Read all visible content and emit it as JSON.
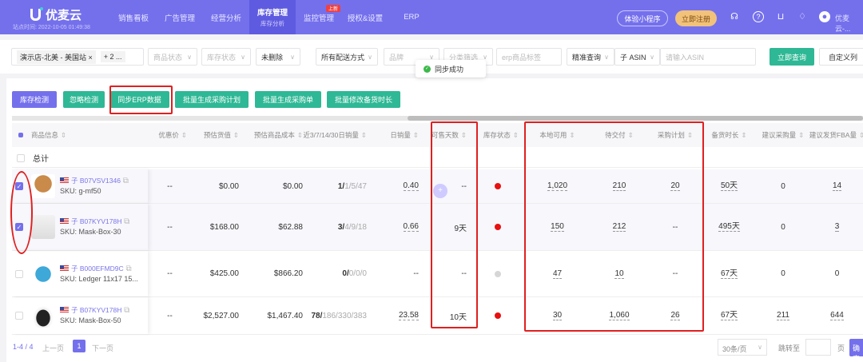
{
  "nav": {
    "brand": "优麦云",
    "site_time": "站点时间: 2022-10-05 01:49:38",
    "menu": [
      {
        "label": "销售看板"
      },
      {
        "label": "广告管理"
      },
      {
        "label": "经营分析"
      },
      {
        "label": "库存管理",
        "sub": "库存分析",
        "active": true
      },
      {
        "label": "监控管理",
        "badge": "上新"
      },
      {
        "label": "授权&设置"
      },
      {
        "label": "ERP"
      }
    ],
    "mini_program": "体验小程序",
    "register": "立即注册",
    "user": "优麦云-..."
  },
  "filters": {
    "shop": "演示店-北美 - 美国站",
    "shop_more": "+ 2 ...",
    "product_status": "商品状态",
    "stock_status": "库存状态",
    "deleted": "未删除",
    "shipping": "所有配送方式",
    "brand": "品牌",
    "category": "分类筛选",
    "erp_tag": "erp商品标签",
    "match": "精准查询",
    "asin_type": "子 ASIN",
    "asin_placeholder": "请输入ASIN",
    "query": "立即查询",
    "custom_cols": "自定义列"
  },
  "toast": "同步成功",
  "actions": [
    "库存检测",
    "忽略检测",
    "同步ERP数据",
    "批量生成采购计划",
    "批量生成采购单",
    "批量修改备货时长"
  ],
  "columns": [
    "商品信息",
    "优惠价",
    "预估货值",
    "预估商品成本",
    "近3/7/14/30日销量",
    "日销量",
    "可售天数",
    "库存状态",
    "本地可用",
    "待交付",
    "采购计划",
    "备货时长",
    "建议采购量",
    "建议发货FBA量"
  ],
  "total_label": "总计",
  "rows": [
    {
      "checked": true,
      "asin": "B07VSV1346",
      "sku": "SKU: g-mf50",
      "discount": "--",
      "value": "$0.00",
      "cost": "$0.00",
      "sales_bold": "1/",
      "sales_rest": "1/5/47",
      "daily": "0.40",
      "days": "--",
      "status_color": "#e81010",
      "local": "1,020",
      "pending": "210",
      "plan": "20",
      "lead": "50天",
      "suggest": "0",
      "fba": "14"
    },
    {
      "checked": true,
      "asin": "B07KYV178H",
      "sku": "SKU: Mask-Box-30",
      "discount": "--",
      "value": "$168.00",
      "cost": "$62.88",
      "sales_bold": "3/",
      "sales_rest": "4/9/18",
      "daily": "0.66",
      "days": "9天",
      "status_color": "#e81010",
      "local": "150",
      "pending": "212",
      "plan": "--",
      "lead": "495天",
      "suggest": "0",
      "fba": "3"
    },
    {
      "checked": false,
      "asin": "B000EFMD9C",
      "sku": "SKU: Ledger 11x17 15...",
      "discount": "--",
      "value": "$425.00",
      "cost": "$866.20",
      "sales_bold": "0/",
      "sales_rest": "0/0/0",
      "daily": "--",
      "days": "--",
      "status_color": "#d6d6d6",
      "local": "47",
      "pending": "10",
      "plan": "--",
      "lead": "67天",
      "suggest": "0",
      "fba": "0"
    },
    {
      "checked": false,
      "asin": "B07KYV178H",
      "sku": "SKU: Mask-Box-50",
      "discount": "--",
      "value": "$2,527.00",
      "cost": "$1,467.40",
      "sales_bold": "78/",
      "sales_rest": "186/330/383",
      "daily": "23.58",
      "days": "10天",
      "status_color": "#e81010",
      "local": "30",
      "pending": "1,060",
      "plan": "26",
      "lead": "67天",
      "suggest": "211",
      "fba": "644"
    }
  ],
  "pager": {
    "range": "1-4 / 4",
    "prev": "上一页",
    "page": "1",
    "next": "下一页",
    "size": "30条/页",
    "jump": "跳转至",
    "page_unit": "页",
    "confirm": "确定"
  }
}
